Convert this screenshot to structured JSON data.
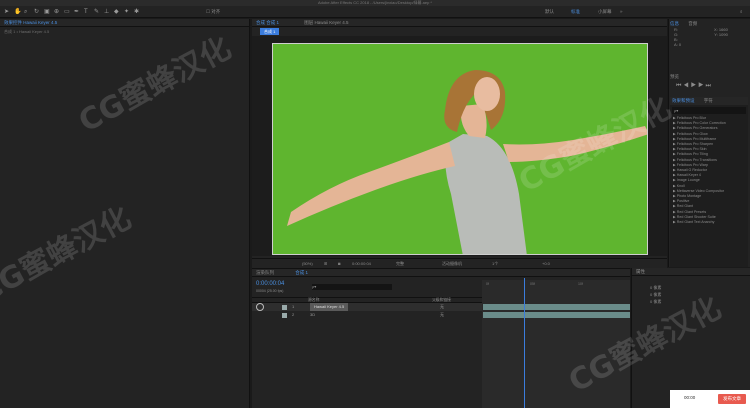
{
  "window": {
    "title": "Adobe After Effects CC 2018 - /Users/jinxiao/Desktop/绿幕.aep *"
  },
  "toolbar": {
    "align_label": "对齐",
    "workspaces": [
      "默认",
      "标准",
      "小屏幕"
    ],
    "active_workspace": "标准",
    "search_icon": "search-icon"
  },
  "left": {
    "tab_label": "效果控件 Hawaii Keyer 4.5",
    "breadcrumb": "合成 1 • Hawaii Keyer 4.5"
  },
  "composition": {
    "tab_label": "合成 合成 1",
    "layer_tab_label": "图层 Hawaii Keyer 4.5",
    "comp_chip": "合成 1"
  },
  "viewer": {
    "zoom": "(50%)",
    "timecode": "0:00:00:04",
    "resolution": "完整",
    "camera": "活动摄像机",
    "views": "1个",
    "offset": "+0.0"
  },
  "info": {
    "title": "信息",
    "audio_tab": "音频",
    "r": "R:",
    "g": "G:",
    "b": "B:",
    "a": "A: 0",
    "x": "X: 1660",
    "y": "Y: 1090"
  },
  "preview": {
    "title": "预览"
  },
  "effects": {
    "title": "效果和预设",
    "tab2": "字符",
    "search_value": "ρ▾",
    "items": [
      "▶ Felicitous Pro Blur",
      "▶ Felicitous Pro Color Correction",
      "▶ Felicitous Pro Generators",
      "▶ Felicitous Pro Glow",
      "▶ Felicitous Pro Multiframe",
      "▶ Felicitous Pro Sharpen",
      "▶ Felicitous Pro Skin",
      "▶ Felicitous Pro Tiling",
      "▶ Felicitous Pro Transitions",
      "▶ Felicitous Pro Warp",
      "▶ Hawaii G Reductor",
      "▶ Hawaii Keyer 4",
      "▶ Image Lounge",
      "▶ Knoll",
      "▶ Mettaverse Video Compositor",
      "▶ Photo Montage",
      "▶ Positive",
      "▶ Red Giant",
      "▶ Red Giant Presets",
      "▶ Red Giant Shooter Suite",
      "▶ Red Giant Text Anarchy"
    ]
  },
  "timeline": {
    "tab_render": "渲染队列",
    "tab_comp": "合成 1",
    "timecode": "0:00:00:04",
    "fps": "00004 (25.00 fps)",
    "search": "ρ▾",
    "col_name": "源名称",
    "col_parent": "父级和链接",
    "layers": [
      {
        "index": "1",
        "name": "Hawaii Keyer 4.5",
        "parent": "无"
      },
      {
        "index": "2",
        "name": "3D",
        "parent": "无"
      }
    ],
    "ruler": [
      "0f",
      "05f",
      "10f"
    ]
  },
  "properties": {
    "title": "属性",
    "rows": [
      "0 像素",
      "0 像素",
      "0 像素"
    ]
  },
  "bottom": {
    "time": "00:00",
    "publish_label": "发布文章"
  },
  "watermark": "CG蜜蜂汉化"
}
